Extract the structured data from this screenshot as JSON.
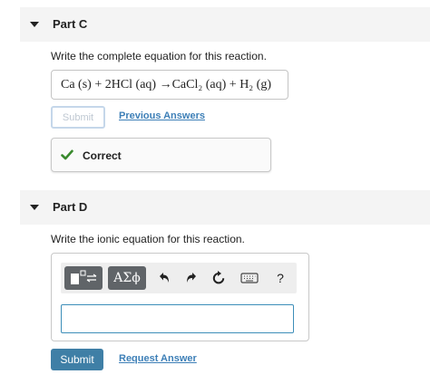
{
  "part_c": {
    "title": "Part C",
    "instruction": "Write the complete equation for this reaction.",
    "equation": "Ca (s) + 2HCl (aq) →CaCl₂ (aq) + H₂ (g)",
    "submit_label": "Submit",
    "previous_answers_label": "Previous Answers",
    "feedback": "Correct"
  },
  "part_d": {
    "title": "Part D",
    "instruction": "Write the ionic equation for this reaction.",
    "toolbar": {
      "templates_icon": "template-fraction-icon",
      "greek_label": "ΑΣϕ",
      "undo_icon": "undo-icon",
      "redo_icon": "redo-icon",
      "reset_icon": "reset-icon",
      "keyboard_icon": "keyboard-icon",
      "help_label": "?"
    },
    "answer_value": "",
    "submit_label": "Submit",
    "request_answer_label": "Request Answer"
  },
  "colors": {
    "link": "#3d7fb7",
    "submit_primary": "#3f7fa6",
    "correct_check": "#3a8a2e",
    "input_border": "#3d8eb9",
    "toolbar_button": "#606468",
    "header_bg": "#f4f4f4"
  }
}
